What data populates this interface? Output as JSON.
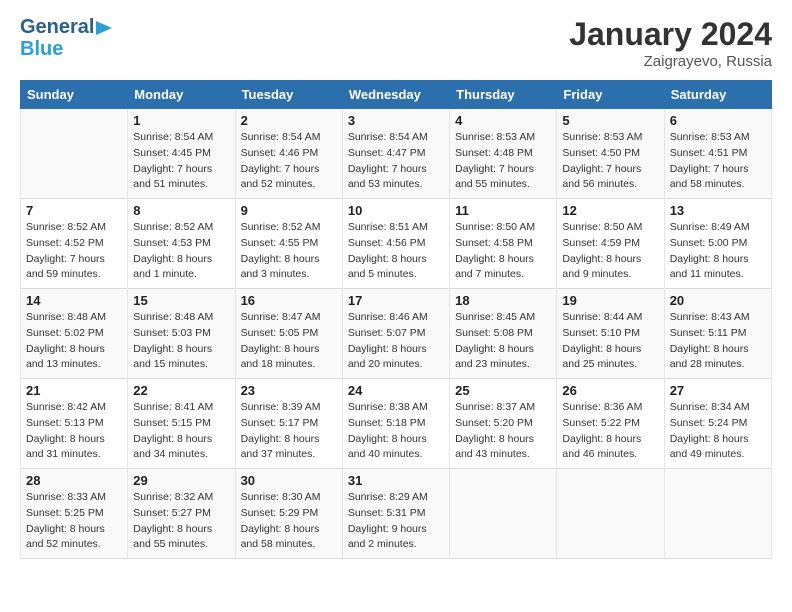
{
  "header": {
    "logo_general": "General",
    "logo_blue": "Blue",
    "month_title": "January 2024",
    "location": "Zaigrayevo, Russia"
  },
  "weekdays": [
    "Sunday",
    "Monday",
    "Tuesday",
    "Wednesday",
    "Thursday",
    "Friday",
    "Saturday"
  ],
  "weeks": [
    [
      {
        "day": "",
        "info": ""
      },
      {
        "day": "1",
        "info": "Sunrise: 8:54 AM\nSunset: 4:45 PM\nDaylight: 7 hours\nand 51 minutes."
      },
      {
        "day": "2",
        "info": "Sunrise: 8:54 AM\nSunset: 4:46 PM\nDaylight: 7 hours\nand 52 minutes."
      },
      {
        "day": "3",
        "info": "Sunrise: 8:54 AM\nSunset: 4:47 PM\nDaylight: 7 hours\nand 53 minutes."
      },
      {
        "day": "4",
        "info": "Sunrise: 8:53 AM\nSunset: 4:48 PM\nDaylight: 7 hours\nand 55 minutes."
      },
      {
        "day": "5",
        "info": "Sunrise: 8:53 AM\nSunset: 4:50 PM\nDaylight: 7 hours\nand 56 minutes."
      },
      {
        "day": "6",
        "info": "Sunrise: 8:53 AM\nSunset: 4:51 PM\nDaylight: 7 hours\nand 58 minutes."
      }
    ],
    [
      {
        "day": "7",
        "info": "Sunrise: 8:52 AM\nSunset: 4:52 PM\nDaylight: 7 hours\nand 59 minutes."
      },
      {
        "day": "8",
        "info": "Sunrise: 8:52 AM\nSunset: 4:53 PM\nDaylight: 8 hours\nand 1 minute."
      },
      {
        "day": "9",
        "info": "Sunrise: 8:52 AM\nSunset: 4:55 PM\nDaylight: 8 hours\nand 3 minutes."
      },
      {
        "day": "10",
        "info": "Sunrise: 8:51 AM\nSunset: 4:56 PM\nDaylight: 8 hours\nand 5 minutes."
      },
      {
        "day": "11",
        "info": "Sunrise: 8:50 AM\nSunset: 4:58 PM\nDaylight: 8 hours\nand 7 minutes."
      },
      {
        "day": "12",
        "info": "Sunrise: 8:50 AM\nSunset: 4:59 PM\nDaylight: 8 hours\nand 9 minutes."
      },
      {
        "day": "13",
        "info": "Sunrise: 8:49 AM\nSunset: 5:00 PM\nDaylight: 8 hours\nand 11 minutes."
      }
    ],
    [
      {
        "day": "14",
        "info": "Sunrise: 8:48 AM\nSunset: 5:02 PM\nDaylight: 8 hours\nand 13 minutes."
      },
      {
        "day": "15",
        "info": "Sunrise: 8:48 AM\nSunset: 5:03 PM\nDaylight: 8 hours\nand 15 minutes."
      },
      {
        "day": "16",
        "info": "Sunrise: 8:47 AM\nSunset: 5:05 PM\nDaylight: 8 hours\nand 18 minutes."
      },
      {
        "day": "17",
        "info": "Sunrise: 8:46 AM\nSunset: 5:07 PM\nDaylight: 8 hours\nand 20 minutes."
      },
      {
        "day": "18",
        "info": "Sunrise: 8:45 AM\nSunset: 5:08 PM\nDaylight: 8 hours\nand 23 minutes."
      },
      {
        "day": "19",
        "info": "Sunrise: 8:44 AM\nSunset: 5:10 PM\nDaylight: 8 hours\nand 25 minutes."
      },
      {
        "day": "20",
        "info": "Sunrise: 8:43 AM\nSunset: 5:11 PM\nDaylight: 8 hours\nand 28 minutes."
      }
    ],
    [
      {
        "day": "21",
        "info": "Sunrise: 8:42 AM\nSunset: 5:13 PM\nDaylight: 8 hours\nand 31 minutes."
      },
      {
        "day": "22",
        "info": "Sunrise: 8:41 AM\nSunset: 5:15 PM\nDaylight: 8 hours\nand 34 minutes."
      },
      {
        "day": "23",
        "info": "Sunrise: 8:39 AM\nSunset: 5:17 PM\nDaylight: 8 hours\nand 37 minutes."
      },
      {
        "day": "24",
        "info": "Sunrise: 8:38 AM\nSunset: 5:18 PM\nDaylight: 8 hours\nand 40 minutes."
      },
      {
        "day": "25",
        "info": "Sunrise: 8:37 AM\nSunset: 5:20 PM\nDaylight: 8 hours\nand 43 minutes."
      },
      {
        "day": "26",
        "info": "Sunrise: 8:36 AM\nSunset: 5:22 PM\nDaylight: 8 hours\nand 46 minutes."
      },
      {
        "day": "27",
        "info": "Sunrise: 8:34 AM\nSunset: 5:24 PM\nDaylight: 8 hours\nand 49 minutes."
      }
    ],
    [
      {
        "day": "28",
        "info": "Sunrise: 8:33 AM\nSunset: 5:25 PM\nDaylight: 8 hours\nand 52 minutes."
      },
      {
        "day": "29",
        "info": "Sunrise: 8:32 AM\nSunset: 5:27 PM\nDaylight: 8 hours\nand 55 minutes."
      },
      {
        "day": "30",
        "info": "Sunrise: 8:30 AM\nSunset: 5:29 PM\nDaylight: 8 hours\nand 58 minutes."
      },
      {
        "day": "31",
        "info": "Sunrise: 8:29 AM\nSunset: 5:31 PM\nDaylight: 9 hours\nand 2 minutes."
      },
      {
        "day": "",
        "info": ""
      },
      {
        "day": "",
        "info": ""
      },
      {
        "day": "",
        "info": ""
      }
    ]
  ]
}
